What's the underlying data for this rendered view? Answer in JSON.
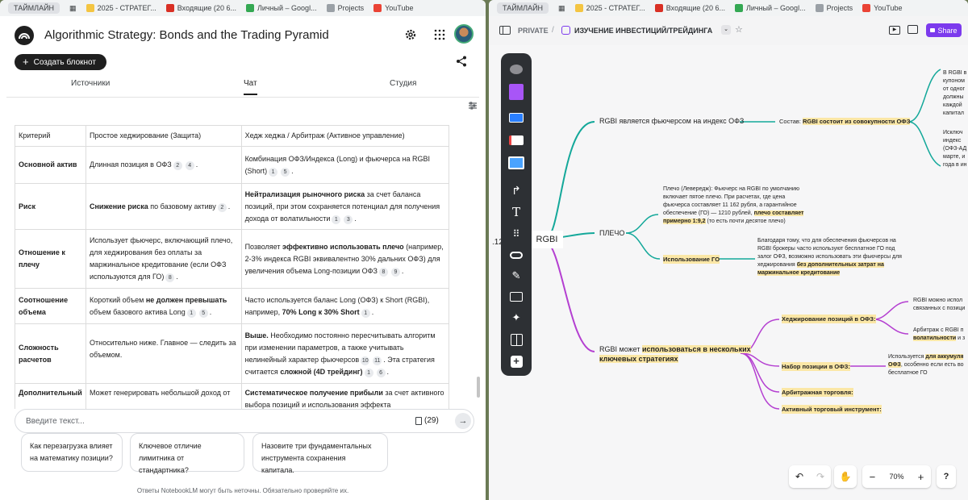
{
  "bookmarks": {
    "timeline": "ТАЙМЛАЙН",
    "items": [
      "2025 - СТРАТЕГ...",
      "Входящие (20 6...",
      "Личный – Googl...",
      "Projects",
      "YouTube"
    ],
    "colors": [
      "#f4c542",
      "#d93025",
      "#34a853",
      "#9aa0a6",
      "#ea4335"
    ]
  },
  "left": {
    "title": "Algorithmic Strategy: Bonds and the Trading Pyramid",
    "create": "Создать блокнот",
    "tabs": [
      "Источники",
      "Чат",
      "Студия"
    ],
    "table": {
      "headers": [
        "Критерий",
        "Простое хеджирование (Защита)",
        "Хедж хеджа / Арбитраж (Активное управление)"
      ],
      "rows": [
        {
          "k": "Основной актив",
          "a": "Длинная позиция в ОФЗ",
          "a_cites": [
            "2",
            "4"
          ],
          "b": "Комбинация ОФЗ/Индекса (Long) и фьючерса на RGBI (Short)",
          "b_cites": [
            "1",
            "5"
          ]
        },
        {
          "k": "Риск",
          "a_bold": "Снижение риска",
          "a": " по базовому активу",
          "a_cites": [
            "2"
          ],
          "b_bold": "Нейтрализация рыночного риска",
          "b": " за счет баланса позиций, при этом сохраняется потенциал для получения дохода от волатильности",
          "b_cites": [
            "1",
            "3"
          ]
        },
        {
          "k": "Отношение к плечу",
          "a": "Использует фьючерс, включающий плечо, для хеджирования без оплаты за маржинальное кредитование (если ОФЗ используются для ГО)",
          "a_cites": [
            "8"
          ],
          "b_pre": "Позволяет ",
          "b_bold": "эффективно использовать плечо",
          "b": " (например, 2-3% индекса RGBI эквивалентно 30% дальних ОФЗ) для увеличения объема Long-позиции ОФЗ",
          "b_cites": [
            "8",
            "9"
          ]
        },
        {
          "k": "Соотношение объема",
          "a_pre": "Короткий объем ",
          "a_bold": "не должен превышать",
          "a": " объем базового актива Long",
          "a_cites": [
            "1",
            "5"
          ],
          "b_pre": "Часто используется баланс Long (ОФЗ) к Short (RGBI), например, ",
          "b_bold": "70% Long к 30% Short",
          "b": "",
          "b_cites": [
            "1"
          ]
        },
        {
          "k": "Сложность расчетов",
          "a": "Относительно ниже. Главное — следить за объемом.",
          "a_cites": [],
          "b_bold": "Выше.",
          "b": " Необходимо постоянно пересчитывать алгоритм при изменении параметров, а также учитывать нелинейный характер фьючерсов",
          "b_cites": [
            "10",
            "11"
          ],
          "b_tail_pre": ". Эта стратегия считается ",
          "b_tail_bold": "сложной (4D трейдинг)",
          "b_tail_cites": [
            "1",
            "6"
          ]
        },
        {
          "k": "Дополнительный",
          "a": "Может генерировать небольшой доход от",
          "a_cites": [],
          "b_bold": "Систематическое получение прибыли",
          "b": " за счет активного выбора позиций и использования эффекта",
          "b_cites": []
        }
      ]
    },
    "input_placeholder": "Введите текст...",
    "source_count": "(29)",
    "suggestions": [
      "Как перезагрузка влияет на математику позиции?",
      "Ключевое отличие лимитника от стандартника?",
      "Назовите три фундаментальных инструмента сохранения капитала."
    ],
    "disclaimer": "Ответы NotebookLM могут быть неточны. Обязательно проверяйте их."
  },
  "right": {
    "private": "PRIVATE",
    "board": "ИЗУЧЕНИЕ ИНВЕСТИЦИЙ/ТРЕЙДИНГА",
    "share": "Share",
    "zoom": "70%",
    "mindmap": {
      "root": "RGBI",
      "root_prefix": ".12",
      "b1": "RGBI является фьючерсом на индекс ОФЗ",
      "b1_sub_pre": "Состав: ",
      "b1_sub_hl": "RGBI состоит из совокупности ОФЗ",
      "right_text_1": [
        "В RGBI в",
        "купоном",
        "от одног",
        "должны",
        "каждой",
        "капитал"
      ],
      "right_text_2": [
        "Исключ",
        "индекс",
        "(ОФЗ-АД",
        "марте, и",
        "года в ин"
      ],
      "b2": "ПЛЕЧО",
      "b2_note": [
        "Плечо (Левередж): Фьючерс на RGBI по умолчанию",
        "включает пятое плечо. При расчетах, где цена",
        "фьючерса составляет 11 162 рубля, а гарантийное",
        "обеспечение (ГО) — 1210 рублей,"
      ],
      "b2_note_hl1": "плечо составляет",
      "b2_note_hl2": "примерно 1:9,2",
      "b2_note_tail": " (то есть почти десятое плечо)",
      "b2_sub": "Использование ГО",
      "b2_sub_text": [
        "Благодаря тому, что для обеспечения фьючерсов на",
        "RGBI брокеры часто используют бесплатное ГО под",
        "залог ОФЗ, возможно использовать эти фьючерсы для",
        "хеджирования"
      ],
      "b2_sub_hl1": "без дополнительных затрат на",
      "b2_sub_hl2": "маржинальное кредитование",
      "b3_pre": "RGBI может ",
      "b3_hl1": "использоваться в нескольких",
      "b3_hl2": "ключевых стратегиях",
      "s1": "Хеджирование позиций в ОФЗ:",
      "s1_t1": [
        "RGBI можно испол",
        "связанных с позици"
      ],
      "s1_t2": "Арбитраж с RGBI п",
      "s1_t2b_pre": "волатильности",
      "s1_t2b": " и з",
      "s2": "Набор позиции в ОФЗ:",
      "s2_t": [
        "Используется ",
        "для аккумуля",
        "ОФЗ",
        ", особенно если есть во",
        "бесплатное ГО"
      ],
      "s3": "Арбитражная торговля:",
      "s4": "Активный торговый инструмент:"
    }
  }
}
